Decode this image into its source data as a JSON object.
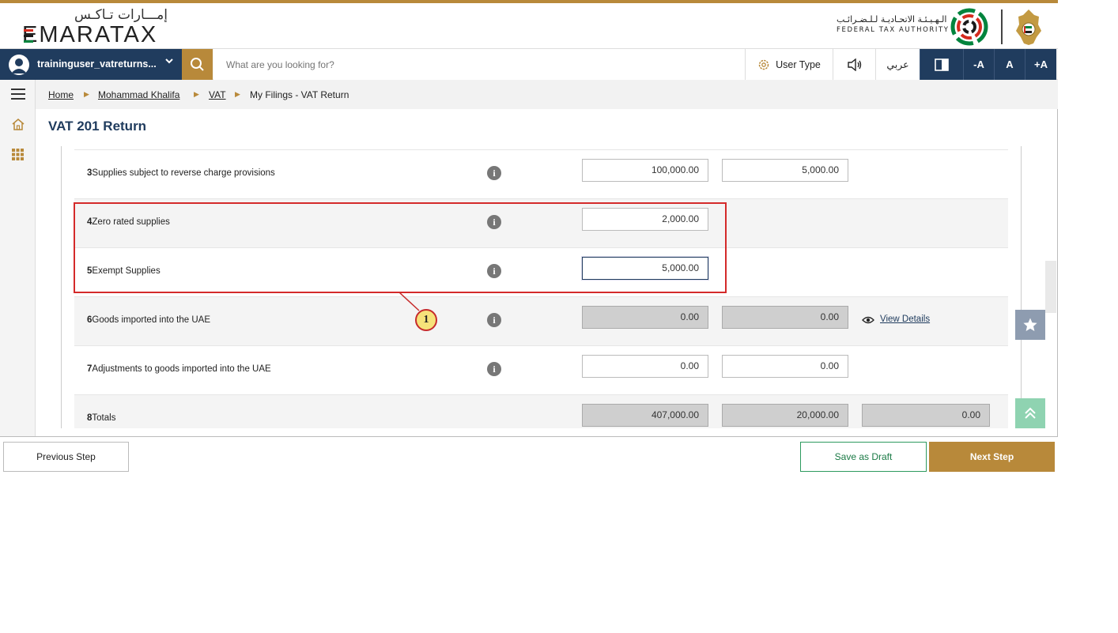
{
  "brand": {
    "logo_ar": "إمـــارات تـاكـس",
    "logo_en": "EMARATAX",
    "fta_ar": "الـهـيـئـة الاتحـاديـة لـلـضـرائـب",
    "fta_en": "FEDERAL TAX AUTHORITY"
  },
  "toolbar": {
    "username": "traininguser_vatreturns...",
    "search_placeholder": "What are you looking for?",
    "user_type": "User Type",
    "language": "عربي",
    "font_decrease": "-A",
    "font_normal": "A",
    "font_increase": "+A"
  },
  "breadcrumb": {
    "home": "Home",
    "user": "Mohammad Khalifa",
    "vat": "VAT",
    "current": "My Filings - VAT Return"
  },
  "page": {
    "title": "VAT 201 Return"
  },
  "rows": [
    {
      "num": "3",
      "label": "Supplies subject to reverse charge provisions",
      "amount": "100,000.00",
      "vat": "5,000.00"
    },
    {
      "num": "4",
      "label": "Zero rated supplies",
      "amount": "2,000.00"
    },
    {
      "num": "5",
      "label": "Exempt Supplies",
      "amount": "5,000.00"
    },
    {
      "num": "6",
      "label": "Goods imported into the UAE",
      "amount": "0.00",
      "vat": "0.00",
      "link": "View Details"
    },
    {
      "num": "7",
      "label": "Adjustments to goods imported into the UAE",
      "amount": "0.00",
      "vat": "0.00"
    },
    {
      "num": "8",
      "label": "Totals",
      "amount": "407,000.00",
      "vat": "20,000.00",
      "adjust": "0.00"
    }
  ],
  "info_icon": "i",
  "annotation": {
    "number": "1"
  },
  "footer": {
    "previous": "Previous Step",
    "save_draft": "Save as Draft",
    "next": "Next Step"
  },
  "colors": {
    "brand_gold": "#b8893a",
    "navy": "#203c5e",
    "draft_green": "#2e9a5f",
    "callout_red": "#d42a2a"
  }
}
